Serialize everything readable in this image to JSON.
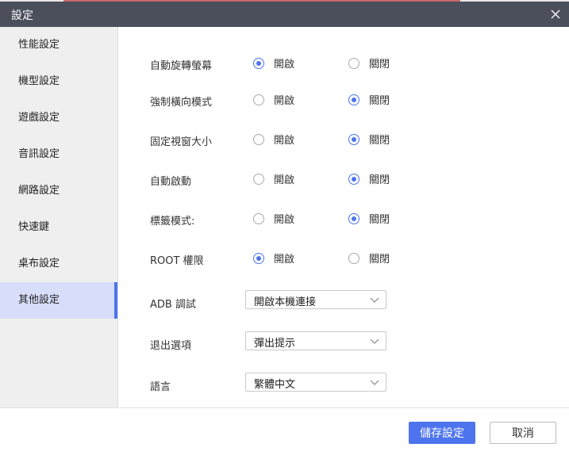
{
  "window": {
    "title": "設定"
  },
  "sidebar": {
    "items": [
      {
        "label": "性能設定",
        "active": false
      },
      {
        "label": "機型設定",
        "active": false
      },
      {
        "label": "遊戲設定",
        "active": false
      },
      {
        "label": "音訊設定",
        "active": false
      },
      {
        "label": "網路設定",
        "active": false
      },
      {
        "label": "快速鍵",
        "active": false
      },
      {
        "label": "桌布設定",
        "active": false
      },
      {
        "label": "其他設定",
        "active": true
      }
    ]
  },
  "settings": {
    "on_label": "開啟",
    "off_label": "關閉",
    "toggles": [
      {
        "label": "自動旋轉螢幕",
        "value": "on"
      },
      {
        "label": "強制橫向模式",
        "value": "off"
      },
      {
        "label": "固定視窗大小",
        "value": "off"
      },
      {
        "label": "自動啟動",
        "value": "off"
      },
      {
        "label": "標籤模式:",
        "value": "off"
      },
      {
        "label": "ROOT 權限",
        "value": "on"
      }
    ],
    "selects": [
      {
        "label": "ADB 調試",
        "value": "開啟本機連接"
      },
      {
        "label": "退出選項",
        "value": "彈出提示"
      },
      {
        "label": "語言",
        "value": "繁體中文"
      }
    ]
  },
  "footer": {
    "save_label": "儲存設定",
    "cancel_label": "取消"
  },
  "colors": {
    "accent": "#4d74ee",
    "titlebar": "#4b4f5c",
    "sidebar_bg": "#efefef",
    "sidebar_active_bg": "#d8defa"
  },
  "icons": {
    "close": "close-icon",
    "dropdown": "chevron-down-icon"
  }
}
